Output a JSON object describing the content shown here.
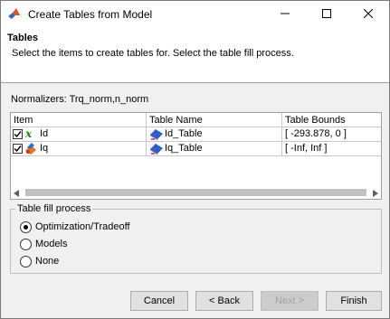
{
  "window": {
    "title": "Create Tables from Model",
    "icons": {
      "app": "matlab-logo-icon",
      "minimize": "minimize-icon",
      "maximize": "maximize-icon",
      "close": "close-icon"
    }
  },
  "header": {
    "title": "Tables",
    "description": "Select the items to create tables for. Select the table fill process."
  },
  "normalizers_label": "Normalizers: Trq_norm,n_norm",
  "table": {
    "columns": [
      "Item",
      "Table Name",
      "Table Bounds"
    ],
    "rows": [
      {
        "checked": true,
        "item_icon": "variable-x-icon",
        "item": "Id",
        "table_icon": "lookup-table-icon",
        "table_name": "Id_Table",
        "bounds": "[ -293.878, 0 ]"
      },
      {
        "checked": true,
        "item_icon": "model-icon",
        "item": "Iq",
        "table_icon": "lookup-table-icon",
        "table_name": "Iq_Table",
        "bounds": "[ -Inf, Inf ]"
      }
    ]
  },
  "fill_process": {
    "legend": "Table fill process",
    "options": [
      "Optimization/Tradeoff",
      "Models",
      "None"
    ],
    "selected": "Optimization/Tradeoff"
  },
  "buttons": {
    "cancel": "Cancel",
    "back": "< Back",
    "next": "Next >",
    "finish": "Finish"
  }
}
